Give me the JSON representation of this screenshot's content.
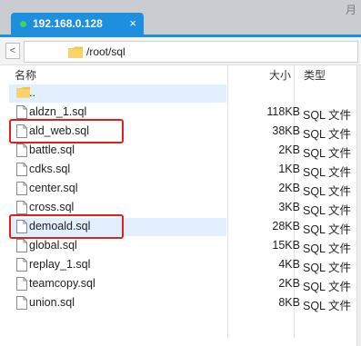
{
  "tab": {
    "title": "192.168.0.128",
    "close": "×"
  },
  "top_right_fragment": "月",
  "nav": {
    "back_arrow": "<"
  },
  "path": {
    "current": "/root/sql"
  },
  "columns": {
    "name": "名称",
    "size": "大小",
    "type": "类型"
  },
  "files": [
    {
      "name": "..",
      "size": "",
      "type": "",
      "kind": "folder",
      "selected": true
    },
    {
      "name": "aldzn_1.sql",
      "size": "118KB",
      "type": "SQL 文件",
      "kind": "file"
    },
    {
      "name": "ald_web.sql",
      "size": "38KB",
      "type": "SQL 文件",
      "kind": "file",
      "highlighted": true
    },
    {
      "name": "battle.sql",
      "size": "2KB",
      "type": "SQL 文件",
      "kind": "file"
    },
    {
      "name": "cdks.sql",
      "size": "1KB",
      "type": "SQL 文件",
      "kind": "file"
    },
    {
      "name": "center.sql",
      "size": "2KB",
      "type": "SQL 文件",
      "kind": "file"
    },
    {
      "name": "cross.sql",
      "size": "3KB",
      "type": "SQL 文件",
      "kind": "file"
    },
    {
      "name": "demoald.sql",
      "size": "28KB",
      "type": "SQL 文件",
      "kind": "file",
      "selected": true,
      "highlighted": true
    },
    {
      "name": "global.sql",
      "size": "15KB",
      "type": "SQL 文件",
      "kind": "file"
    },
    {
      "name": "replay_1.sql",
      "size": "4KB",
      "type": "SQL 文件",
      "kind": "file"
    },
    {
      "name": "teamcopy.sql",
      "size": "2KB",
      "type": "SQL 文件",
      "kind": "file"
    },
    {
      "name": "union.sql",
      "size": "8KB",
      "type": "SQL 文件",
      "kind": "file"
    }
  ],
  "colors": {
    "tab": "#1d8fdd",
    "selection": "#e2efff",
    "highlight": "#e02020",
    "folder": "#f5c542"
  }
}
